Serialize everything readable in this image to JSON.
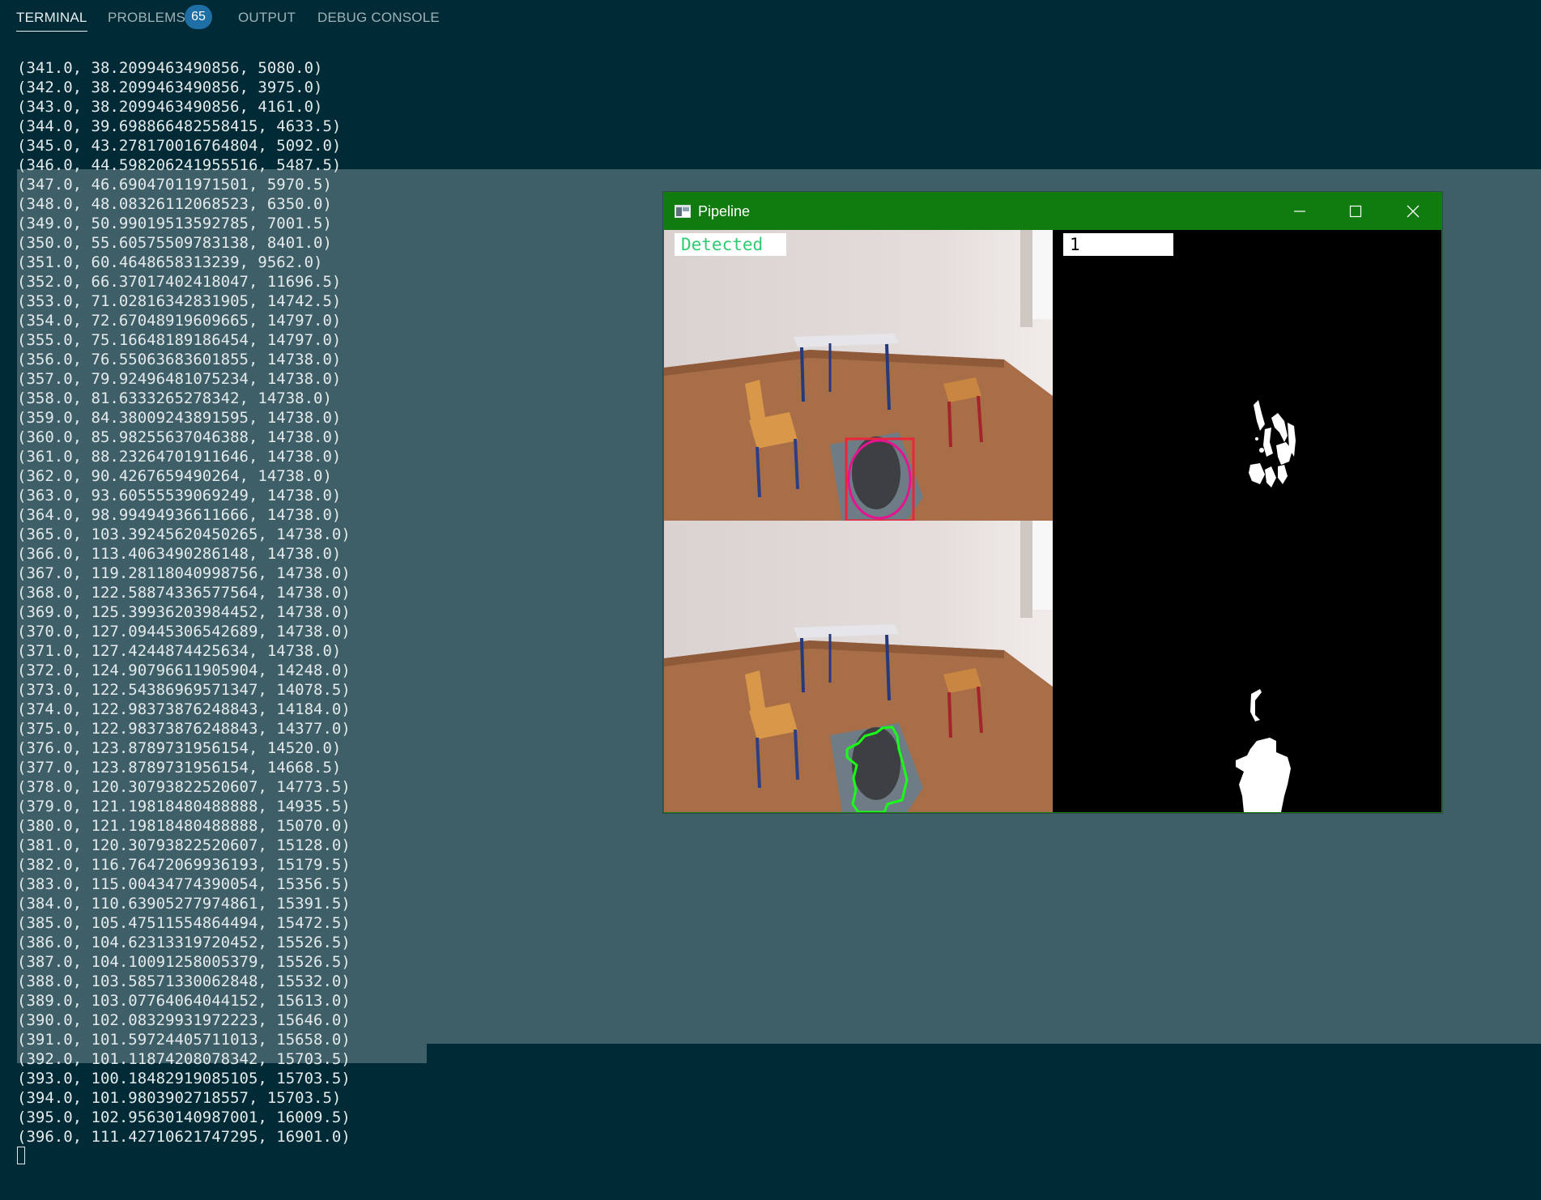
{
  "tabs": [
    {
      "label": "TERMINAL",
      "active": true
    },
    {
      "label": "PROBLEMS",
      "badge": "65"
    },
    {
      "label": "OUTPUT"
    },
    {
      "label": "DEBUG CONSOLE"
    }
  ],
  "colors": {
    "terminal_bg": "#002b36",
    "selection": "#3f5f68",
    "titlebar": "#107c10",
    "badge": "#1d6fa5",
    "detected_text": "#2ecc71"
  },
  "terminal": {
    "lines": [
      "(341.0, 38.2099463490856, 5080.0)",
      "(342.0, 38.2099463490856, 3975.0)",
      "(343.0, 38.2099463490856, 4161.0)",
      "(344.0, 39.698866482558415, 4633.5)",
      "(345.0, 43.278170016764804, 5092.0)",
      "(346.0, 44.598206241955516, 5487.5)",
      "(347.0, 46.69047011971501, 5970.5)",
      "(348.0, 48.08326112068523, 6350.0)",
      "(349.0, 50.99019513592785, 7001.5)",
      "(350.0, 55.60575509783138, 8401.0)",
      "(351.0, 60.4648658313239, 9562.0)",
      "(352.0, 66.37017402418047, 11696.5)",
      "(353.0, 71.02816342831905, 14742.5)",
      "(354.0, 72.67048919609665, 14797.0)",
      "(355.0, 75.16648189186454, 14797.0)",
      "(356.0, 76.55063683601855, 14738.0)",
      "(357.0, 79.92496481075234, 14738.0)",
      "(358.0, 81.6333265278342, 14738.0)",
      "(359.0, 84.38009243891595, 14738.0)",
      "(360.0, 85.98255637046388, 14738.0)",
      "(361.0, 88.23264701911646, 14738.0)",
      "(362.0, 90.4267659490264, 14738.0)",
      "(363.0, 93.60555539069249, 14738.0)",
      "(364.0, 98.99494936611666, 14738.0)",
      "(365.0, 103.39245620450265, 14738.0)",
      "(366.0, 113.4063490286148, 14738.0)",
      "(367.0, 119.28118040998756, 14738.0)",
      "(368.0, 122.58874336577564, 14738.0)",
      "(369.0, 125.39936203984452, 14738.0)",
      "(370.0, 127.09445306542689, 14738.0)",
      "(371.0, 127.4244874425634, 14738.0)",
      "(372.0, 124.90796611905904, 14248.0)",
      "(373.0, 122.54386969571347, 14078.5)",
      "(374.0, 122.98373876248843, 14184.0)",
      "(375.0, 122.98373876248843, 14377.0)",
      "(376.0, 123.8789731956154, 14520.0)",
      "(377.0, 123.8789731956154, 14668.5)",
      "(378.0, 120.30793822520607, 14773.5)",
      "(379.0, 121.19818480488888, 14935.5)",
      "(380.0, 121.19818480488888, 15070.0)",
      "(381.0, 120.30793822520607, 15128.0)",
      "(382.0, 116.76472069936193, 15179.5)",
      "(383.0, 115.00434774390054, 15356.5)",
      "(384.0, 110.63905277974861, 15391.5)",
      "(385.0, 105.47511554864494, 15472.5)",
      "(386.0, 104.62313319720452, 15526.5)",
      "(387.0, 104.10091258005379, 15526.5)",
      "(388.0, 103.58571330062848, 15532.0)",
      "(389.0, 103.07764064044152, 15613.0)",
      "(390.0, 102.08329931972223, 15646.0)",
      "(391.0, 101.59724405711013, 15658.0)",
      "(392.0, 101.11874208078342, 15703.5)",
      "(393.0, 100.18482919085105, 15703.5)",
      "(394.0, 101.9803902718557, 15703.5)",
      "(395.0, 102.95630140987001, 16009.5)",
      "(396.0, 111.42710621747295, 16901.0)"
    ]
  },
  "window": {
    "title": "Pipeline",
    "detected_label": "Detected",
    "count_label": "1",
    "icons": [
      "app-icon",
      "minimize-icon",
      "maximize-icon",
      "close-icon"
    ]
  }
}
